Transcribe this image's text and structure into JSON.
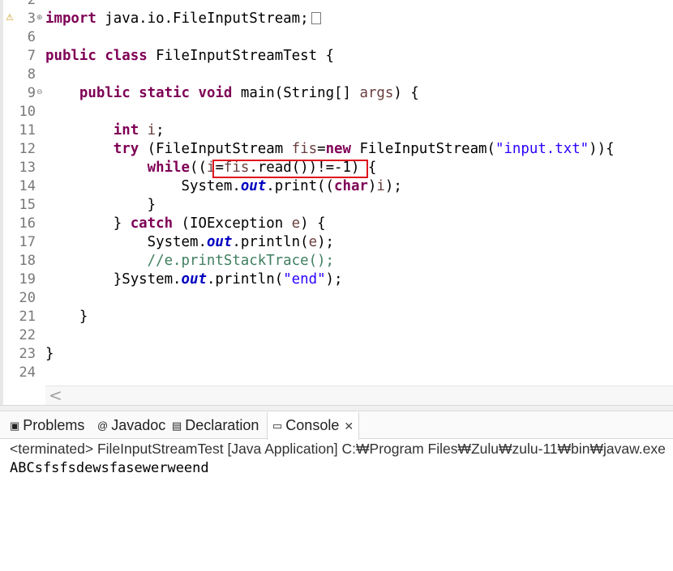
{
  "editor": {
    "lines": [
      {
        "num": "2",
        "segments": []
      },
      {
        "num": "3",
        "fold": "⊕",
        "warn": true,
        "segments": [
          {
            "t": "import",
            "c": "kw"
          },
          {
            "t": " java.io.FileInputStream;",
            "c": ""
          }
        ],
        "collapsed": true
      },
      {
        "num": "6",
        "segments": []
      },
      {
        "num": "7",
        "segments": [
          {
            "t": "public",
            "c": "kw"
          },
          {
            "t": " ",
            "c": ""
          },
          {
            "t": "class",
            "c": "kw"
          },
          {
            "t": " FileInputStreamTest {",
            "c": ""
          }
        ]
      },
      {
        "num": "8",
        "segments": []
      },
      {
        "num": "9",
        "fold": "⊖",
        "segments": [
          {
            "t": "    ",
            "c": ""
          },
          {
            "t": "public",
            "c": "kw"
          },
          {
            "t": " ",
            "c": ""
          },
          {
            "t": "static",
            "c": "kw"
          },
          {
            "t": " ",
            "c": ""
          },
          {
            "t": "void",
            "c": "kw"
          },
          {
            "t": " main(String[] ",
            "c": ""
          },
          {
            "t": "args",
            "c": "var"
          },
          {
            "t": ") {",
            "c": ""
          }
        ]
      },
      {
        "num": "10",
        "segments": []
      },
      {
        "num": "11",
        "segments": [
          {
            "t": "        ",
            "c": ""
          },
          {
            "t": "int",
            "c": "kw"
          },
          {
            "t": " ",
            "c": ""
          },
          {
            "t": "i",
            "c": "var"
          },
          {
            "t": ";",
            "c": ""
          }
        ]
      },
      {
        "num": "12",
        "segments": [
          {
            "t": "        ",
            "c": ""
          },
          {
            "t": "try",
            "c": "kw"
          },
          {
            "t": " (FileInputStream ",
            "c": ""
          },
          {
            "t": "fis",
            "c": "var"
          },
          {
            "t": "=",
            "c": ""
          },
          {
            "t": "new",
            "c": "kw"
          },
          {
            "t": " FileInputStream(",
            "c": ""
          },
          {
            "t": "\"input.txt\"",
            "c": "str"
          },
          {
            "t": ")){",
            "c": ""
          }
        ]
      },
      {
        "num": "13",
        "segments": [
          {
            "t": "            ",
            "c": ""
          },
          {
            "t": "while",
            "c": "kw"
          },
          {
            "t": "((",
            "c": ""
          },
          {
            "t": "i",
            "c": "var"
          },
          {
            "t": "=",
            "c": ""
          },
          {
            "t": "fis",
            "c": "var"
          },
          {
            "t": ".read())!=-1) {",
            "c": ""
          }
        ]
      },
      {
        "num": "14",
        "segments": [
          {
            "t": "                System.",
            "c": ""
          },
          {
            "t": "out",
            "c": "fld"
          },
          {
            "t": ".print((",
            "c": ""
          },
          {
            "t": "char",
            "c": "kw"
          },
          {
            "t": ")",
            "c": ""
          },
          {
            "t": "i",
            "c": "var"
          },
          {
            "t": ");",
            "c": ""
          }
        ]
      },
      {
        "num": "15",
        "segments": [
          {
            "t": "            }",
            "c": ""
          }
        ]
      },
      {
        "num": "16",
        "segments": [
          {
            "t": "        } ",
            "c": ""
          },
          {
            "t": "catch",
            "c": "kw"
          },
          {
            "t": " (IOException ",
            "c": ""
          },
          {
            "t": "e",
            "c": "var"
          },
          {
            "t": ") {",
            "c": ""
          }
        ]
      },
      {
        "num": "17",
        "segments": [
          {
            "t": "            System.",
            "c": ""
          },
          {
            "t": "out",
            "c": "fld"
          },
          {
            "t": ".println(",
            "c": ""
          },
          {
            "t": "e",
            "c": "var"
          },
          {
            "t": ");",
            "c": ""
          }
        ]
      },
      {
        "num": "18",
        "segments": [
          {
            "t": "            ",
            "c": ""
          },
          {
            "t": "//e.printStackTrace();",
            "c": "cmt"
          }
        ]
      },
      {
        "num": "19",
        "segments": [
          {
            "t": "        }System.",
            "c": ""
          },
          {
            "t": "out",
            "c": "fld"
          },
          {
            "t": ".println(",
            "c": ""
          },
          {
            "t": "\"end\"",
            "c": "str"
          },
          {
            "t": ");",
            "c": ""
          }
        ]
      },
      {
        "num": "20",
        "segments": []
      },
      {
        "num": "21",
        "segments": [
          {
            "t": "    }",
            "c": ""
          }
        ]
      },
      {
        "num": "22",
        "segments": []
      },
      {
        "num": "23",
        "segments": [
          {
            "t": "}",
            "c": ""
          }
        ]
      },
      {
        "num": "24",
        "segments": []
      }
    ],
    "scroll_left_glyph": "<"
  },
  "panel": {
    "tabs": [
      {
        "name": "problems",
        "icon": "▣",
        "label": "Problems"
      },
      {
        "name": "javadoc",
        "icon": "@",
        "label": "Javadoc"
      },
      {
        "name": "declaration",
        "icon": "▤",
        "label": "Declaration"
      },
      {
        "name": "console",
        "icon": "▭",
        "label": "Console",
        "active": true
      }
    ],
    "close_glyph": "✕",
    "status": "<terminated> FileInputStreamTest [Java Application] C:₩Program Files₩Zulu₩zulu-11₩bin₩javaw.exe",
    "output": "ABCsfsfsdewsfasewerweend"
  },
  "colors": {
    "keyword": "#7f0055",
    "string": "#2a00ff",
    "field": "#0000c0",
    "local_variable": "#6a3e3e",
    "comment": "#3f7f5f",
    "highlight_box": "#e0141e"
  }
}
